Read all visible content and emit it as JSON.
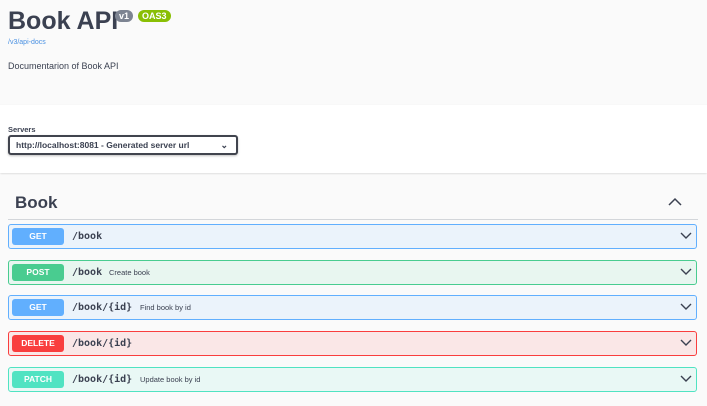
{
  "info": {
    "title": "Book API",
    "version_badge": "v1",
    "oas_badge": "OAS3",
    "docs_link": "/v3/api-docs",
    "description": "Documentarion of Book API"
  },
  "servers": {
    "label": "Servers",
    "selected": "http://localhost:8081 - Generated server url"
  },
  "tag": {
    "name": "Book"
  },
  "operations": [
    {
      "method": "GET",
      "path": "/book",
      "summary": ""
    },
    {
      "method": "POST",
      "path": "/book",
      "summary": "Create book"
    },
    {
      "method": "GET",
      "path": "/book/{id}",
      "summary": "Find book by id"
    },
    {
      "method": "DELETE",
      "path": "/book/{id}",
      "summary": ""
    },
    {
      "method": "PATCH",
      "path": "/book/{id}",
      "summary": "Update book by id"
    }
  ],
  "colors": {
    "get": "#61affe",
    "post": "#49cc90",
    "delete": "#f93e3e",
    "patch": "#50e3c2",
    "version_badge": "#7d8492",
    "oas_badge": "#89bf04",
    "link": "#4990e2"
  },
  "icons": {
    "collapse": "chevron-up-icon",
    "expand": "chevron-down-icon",
    "select": "chevron-down-icon"
  }
}
